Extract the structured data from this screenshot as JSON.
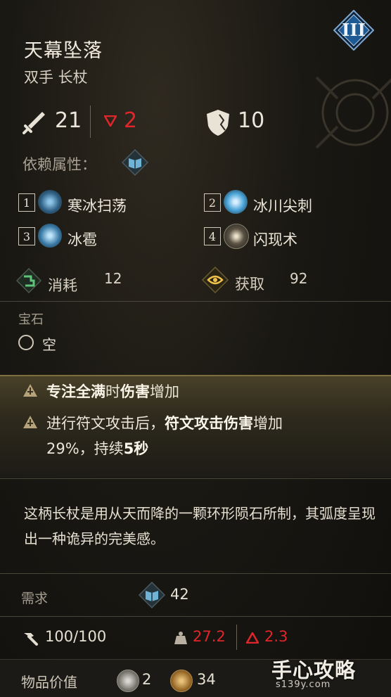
{
  "item": {
    "name": "天幕坠落",
    "type": "双手 长杖",
    "tier": "III"
  },
  "stats": {
    "damage": "21",
    "damage_delta": "2",
    "defense": "10"
  },
  "scaling": {
    "label": "依赖属性："
  },
  "skills": [
    {
      "num": "1",
      "name": "寒冰扫荡"
    },
    {
      "num": "2",
      "name": "冰川尖刺"
    },
    {
      "num": "3",
      "name": "冰雹"
    },
    {
      "num": "4",
      "name": "闪现术"
    }
  ],
  "costs": {
    "consume_label": "消耗",
    "consume_value": "12",
    "gain_label": "获取",
    "gain_value": "92"
  },
  "gem": {
    "header": "宝石",
    "slot": "空"
  },
  "effects": {
    "e1_a": "专注全满",
    "e1_b": "时",
    "e1_c": "伤害",
    "e1_d": "增加",
    "e2_a": "进行符文攻击后，",
    "e2_b": "符文攻击伤害",
    "e2_c": "增加",
    "e2_d": "29%，持续",
    "e2_e": "5秒"
  },
  "description": "这柄长杖是用从天而降的一颗环形陨石所制，其弧度呈现出一种诡异的完美感。",
  "requirement": {
    "label": "需求",
    "value": "42"
  },
  "footer_stats": {
    "durability": "100/100",
    "weight": "27.2",
    "weight_delta": "2.3"
  },
  "value": {
    "label": "物品价值",
    "silver": "2",
    "gold": "34"
  },
  "watermark": {
    "main": "手心攻略",
    "sub": "s139y.com"
  },
  "colors": {
    "accent_blue": "#1e5a94",
    "negative_red": "#e0262a",
    "gold_band": "#4a4128"
  }
}
